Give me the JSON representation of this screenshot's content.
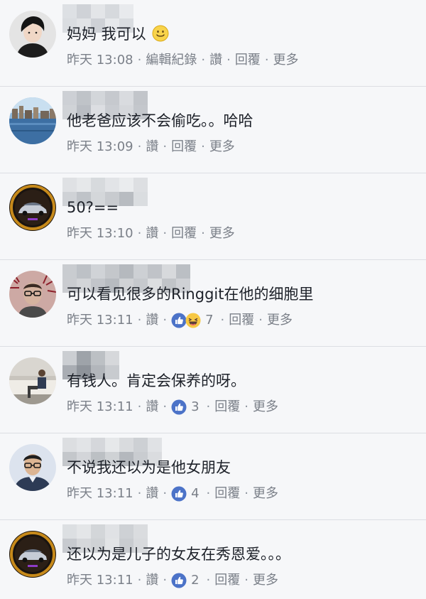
{
  "comments": [
    {
      "text": "妈妈 我可以",
      "has_emoji": true,
      "time": "昨天 13:08",
      "actions": [
        "編輯紀錄",
        "讚",
        "回覆",
        "更多"
      ],
      "reactions": null
    },
    {
      "text": "他老爸应该不会偷吃。。哈哈",
      "has_emoji": false,
      "time": "昨天 13:09",
      "actions": [
        "讚",
        "回覆",
        "更多"
      ],
      "reactions": null
    },
    {
      "text": "50?==",
      "has_emoji": false,
      "time": "昨天 13:10",
      "actions": [
        "讚",
        "回覆",
        "更多"
      ],
      "reactions": null
    },
    {
      "text": "可以看见很多的Ringgit在他的细胞里",
      "has_emoji": false,
      "time": "昨天 13:11",
      "actions": [
        "讚",
        "回覆",
        "更多"
      ],
      "reactions": {
        "count": "7",
        "icons": [
          "like-icon",
          "haha-icon"
        ]
      }
    },
    {
      "text": "有钱人。肯定会保养的呀。",
      "has_emoji": false,
      "time": "昨天 13:11",
      "actions": [
        "讚",
        "回覆",
        "更多"
      ],
      "reactions": {
        "count": "3",
        "icons": [
          "like-icon"
        ]
      }
    },
    {
      "text": "不说我还以为是他女朋友",
      "has_emoji": false,
      "time": "昨天 13:11",
      "actions": [
        "讚",
        "回覆",
        "更多"
      ],
      "reactions": {
        "count": "4",
        "icons": [
          "like-icon"
        ]
      }
    },
    {
      "text": "还以为是儿子的女友在秀恩爱。。。",
      "has_emoji": false,
      "time": "昨天 13:11",
      "actions": [
        "讚",
        "回覆",
        "更多"
      ],
      "reactions": {
        "count": "2",
        "icons": [
          "like-icon"
        ]
      }
    }
  ],
  "colors": {
    "background": "#f6f7f9",
    "meta_text": "#7b8089",
    "like_blue": "#4267b2",
    "haha_yellow": "#f7c844",
    "divider": "#dcdee3"
  }
}
